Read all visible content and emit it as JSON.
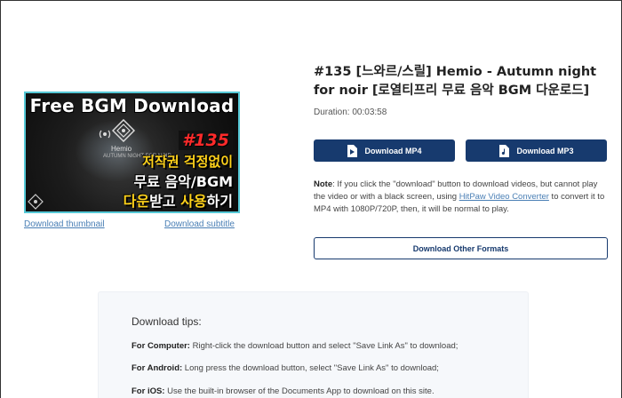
{
  "thumbnail": {
    "title": "Free BGM Download",
    "badge": "#135",
    "line1": "저작권 걱정없이",
    "line2": "무료 음악/BGM",
    "line3_a": "다운",
    "line3_b": "받고 ",
    "line3_c": "사용",
    "line3_d": "하기",
    "brand": "Hemio",
    "brand_sub": "AUTUMN NIGHT FOR NOIR",
    "border_color": "#55c8d6"
  },
  "links": {
    "download_thumbnail": "Download thumbnail",
    "download_subtitle": "Download subtitle"
  },
  "video": {
    "title": "#135 [느와르/스릴] Hemio - Autumn night for noir [로열티프리 무료 음악 BGM 다운로드]",
    "duration": "Duration: 00:03:58"
  },
  "buttons": {
    "mp4": "Download MP4",
    "mp3": "Download MP3",
    "other_formats": "Download Other Formats",
    "primary_color": "#173a6e"
  },
  "note": {
    "label": "Note",
    "text_before": ": If you click the \"download\" button to download videos, but cannot play the video or with a black screen, using ",
    "link": "HitPaw Video Converter",
    "text_after": " to convert it to MP4 with 1080P/720P, then, it will be normal to play."
  },
  "tips": {
    "title": "Download tips:",
    "computer_label": "For Computer:",
    "computer_text": " Right-click the download button and select \"Save Link As\" to download;",
    "android_label": "For Android:",
    "android_text": " Long press the download button, select \"Save Link As\" to download;",
    "ios_label": "For iOS:",
    "ios_text": " Use the built-in browser of the Documents App to download on this site."
  }
}
